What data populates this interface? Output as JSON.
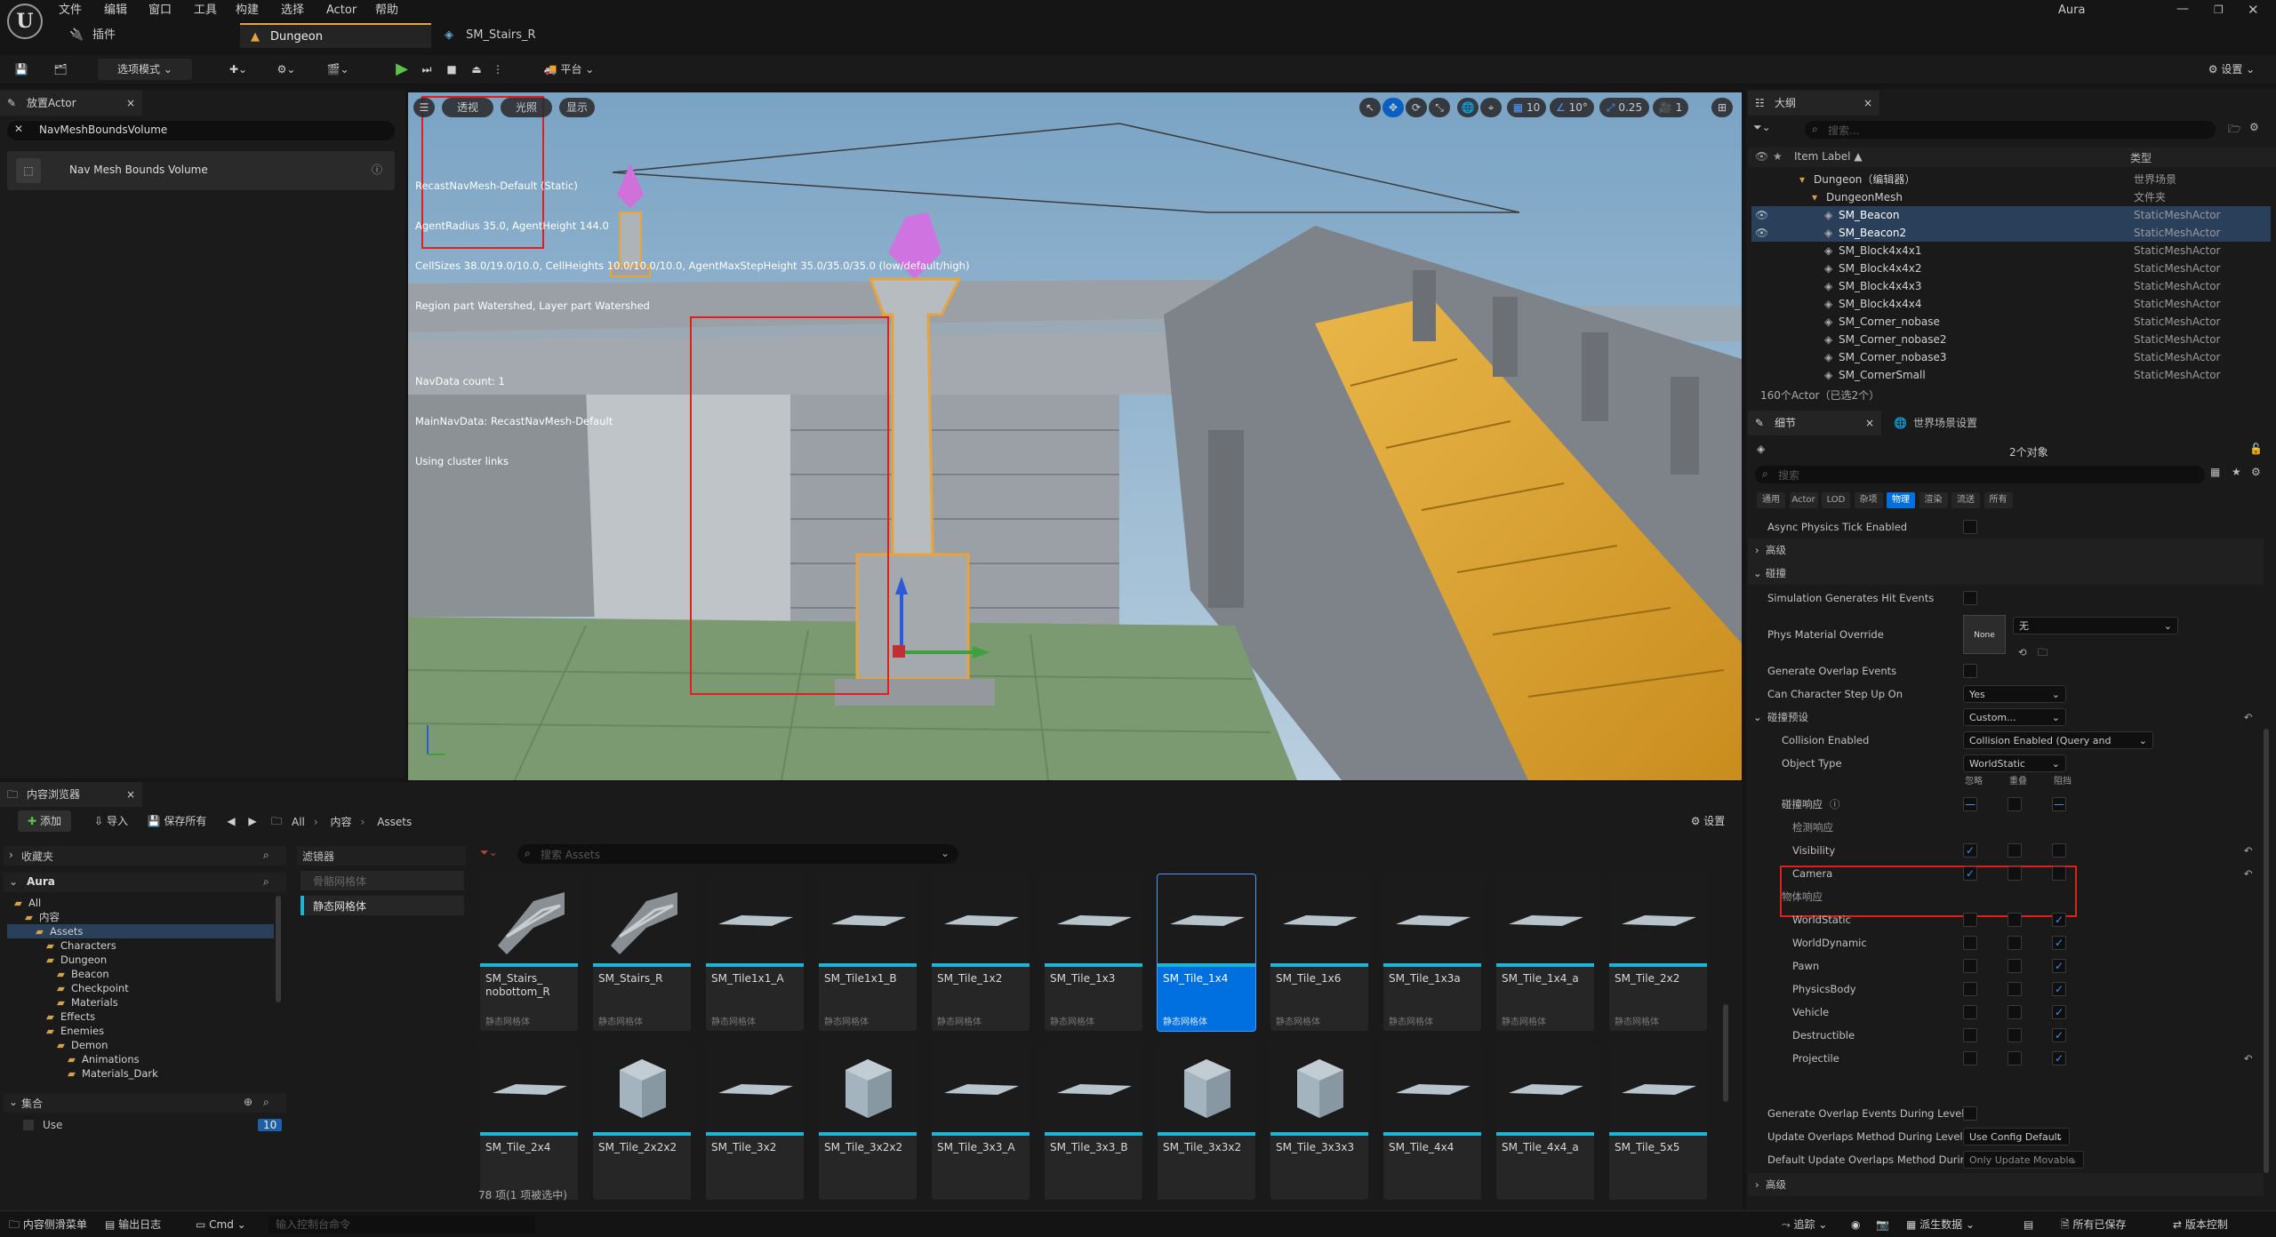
{
  "menubar": {
    "items": [
      "文件",
      "编辑",
      "窗口",
      "工具",
      "构建",
      "选择",
      "Actor",
      "帮助"
    ],
    "user": "Aura",
    "plugin_tab": "插件",
    "tabs": [
      "Dungeon",
      "SM_Stairs_R"
    ]
  },
  "toolbar": {
    "mode_label": "选项模式",
    "platform_label": "平台",
    "settings_label": "设置"
  },
  "place_actor": {
    "tab_label": "放置Actor",
    "search_value": "NavMeshBoundsVolume",
    "result_label": "Nav Mesh Bounds Volume"
  },
  "viewport": {
    "perspective_label": "透视",
    "lit_label": "光照",
    "show_label": "显示",
    "grid_value": "10",
    "angle_value": "10°",
    "scale_value": "0.25",
    "camera_speed": "1",
    "debug_lines": [
      "RecastNavMesh-Default (Static)",
      "AgentRadius 35.0, AgentHeight 144.0",
      "CellSizes 38.0/19.0/10.0, CellHeights 10.0/10.0/10.0, AgentMaxStepHeight 35.0/35.0/35.0 (low/default/high)",
      "Region part Watershed, Layer part Watershed",
      "",
      "NavData count: 1",
      "MainNavData: RecastNavMesh-Default",
      "Using cluster links"
    ]
  },
  "outliner": {
    "tab_label": "大纲",
    "search_placeholder": "搜索...",
    "col_label": "Item Label ▲",
    "col_type": "类型",
    "rows": [
      {
        "label": "Dungeon（编辑器）",
        "type": "世界场景",
        "indent": 1,
        "sel": false,
        "eye": false
      },
      {
        "label": "DungeonMesh",
        "type": "文件夹",
        "indent": 2,
        "sel": false,
        "eye": false
      },
      {
        "label": "SM_Beacon",
        "type": "StaticMeshActor",
        "indent": 3,
        "sel": true,
        "eye": true
      },
      {
        "label": "SM_Beacon2",
        "type": "StaticMeshActor",
        "indent": 3,
        "sel": true,
        "eye": true
      },
      {
        "label": "SM_Block4x4x1",
        "type": "StaticMeshActor",
        "indent": 3,
        "sel": false,
        "eye": false
      },
      {
        "label": "SM_Block4x4x2",
        "type": "StaticMeshActor",
        "indent": 3,
        "sel": false,
        "eye": false
      },
      {
        "label": "SM_Block4x4x3",
        "type": "StaticMeshActor",
        "indent": 3,
        "sel": false,
        "eye": false
      },
      {
        "label": "SM_Block4x4x4",
        "type": "StaticMeshActor",
        "indent": 3,
        "sel": false,
        "eye": false
      },
      {
        "label": "SM_Corner_nobase",
        "type": "StaticMeshActor",
        "indent": 3,
        "sel": false,
        "eye": false
      },
      {
        "label": "SM_Corner_nobase2",
        "type": "StaticMeshActor",
        "indent": 3,
        "sel": false,
        "eye": false
      },
      {
        "label": "SM_Corner_nobase3",
        "type": "StaticMeshActor",
        "indent": 3,
        "sel": false,
        "eye": false
      },
      {
        "label": "SM_CornerSmall",
        "type": "StaticMeshActor",
        "indent": 3,
        "sel": false,
        "eye": false
      }
    ],
    "footer": "160个Actor（已选2个）"
  },
  "details": {
    "tab_label": "细节",
    "world_tab_label": "世界场景设置",
    "object_count": "2个对象",
    "search_placeholder": "搜索",
    "filters": [
      "通用",
      "Actor",
      "LOD",
      "杂项",
      "物理",
      "渲染",
      "流送",
      "所有"
    ],
    "active_filter": "物理",
    "rows": {
      "async": "Async Physics Tick Enabled",
      "advanced1": "高级",
      "collision": "碰撞",
      "sim_hit": "Simulation Generates Hit Events",
      "phys_mat": "Phys Material Override",
      "phys_mat_none": "None",
      "phys_mat_value": "无",
      "gen_overlap": "Generate Overlap Events",
      "step_up": "Can Character Step Up On",
      "step_up_value": "Yes",
      "presets": "碰撞预设",
      "presets_value": "Custom...",
      "coll_enabled": "Collision Enabled",
      "coll_enabled_value": "Collision Enabled (Query and Physics)",
      "obj_type": "Object Type",
      "obj_type_value": "WorldStatic",
      "col_ignore": "忽略",
      "col_overlap": "重叠",
      "col_block": "阻挡",
      "responses": "碰撞响应",
      "trace_resp": "检测响应",
      "visibility": "Visibility",
      "camera": "Camera",
      "obj_resp": "物体响应",
      "world_static": "WorldStatic",
      "world_dynamic": "WorldDynamic",
      "pawn": "Pawn",
      "physics_body": "PhysicsBody",
      "vehicle": "Vehicle",
      "destructible": "Destructible",
      "projectile": "Projectile",
      "gen_overlap_level": "Generate Overlap Events During Level...",
      "update_method": "Update Overlaps Method During Level...",
      "update_method_value": "Use Config Default",
      "default_update": "Default Update Overlaps Method During...",
      "default_update_value": "Only Update Movable",
      "advanced2": "高级"
    }
  },
  "content_browser": {
    "tab_label": "内容浏览器",
    "add_label": "添加",
    "import_label": "导入",
    "save_all_label": "保存所有",
    "breadcrumb": [
      "All",
      "内容",
      "Assets"
    ],
    "settings_label": "设置",
    "favorites_label": "收藏夹",
    "project_label": "Aura",
    "filters_label": "滤镜器",
    "filter_items": [
      "骨骼网格体",
      "静态网格体"
    ],
    "search_placeholder": "搜索 Assets",
    "tree": [
      {
        "label": "All",
        "depth": 0
      },
      {
        "label": "内容",
        "depth": 1
      },
      {
        "label": "Assets",
        "depth": 2
      },
      {
        "label": "Characters",
        "depth": 3
      },
      {
        "label": "Dungeon",
        "depth": 3
      },
      {
        "label": "Beacon",
        "depth": 4
      },
      {
        "label": "Checkpoint",
        "depth": 4
      },
      {
        "label": "Materials",
        "depth": 4
      },
      {
        "label": "Effects",
        "depth": 3
      },
      {
        "label": "Enemies",
        "depth": 3
      },
      {
        "label": "Demon",
        "depth": 4
      },
      {
        "label": "Animations",
        "depth": 5
      },
      {
        "label": "Materials_Dark",
        "depth": 5
      }
    ],
    "collections_label": "集合",
    "collection_item": "Use",
    "collection_count": "10",
    "asset_type": "静态网格体",
    "assets_row1": [
      "SM_Stairs_\nnobottom_R",
      "SM_Stairs_R",
      "SM_Tile1x1_A",
      "SM_Tile1x1_B",
      "SM_Tile_1x2",
      "SM_Tile_1x3",
      "SM_Tile_1x4",
      "SM_Tile_1x6",
      "SM_Tile_1x3a",
      "SM_Tile_1x4_a",
      "SM_Tile_2x2"
    ],
    "assets_row2": [
      "SM_Tile_2x4",
      "SM_Tile_2x2x2",
      "SM_Tile_3x2",
      "SM_Tile_3x2x2",
      "SM_Tile_3x3_A",
      "SM_Tile_3x3_B",
      "SM_Tile_3x3x2",
      "SM_Tile_3x3x3",
      "SM_Tile_4x4",
      "SM_Tile_4x4_a",
      "SM_Tile_5x5"
    ],
    "selected_asset": "SM_Tile_1x4",
    "item_count": "78 项(1 项被选中)"
  },
  "statusbar": {
    "drawer": "内容侧滑菜单",
    "output_log": "输出日志",
    "cmd": "Cmd",
    "cmd_placeholder": "输入控制台命令",
    "trace": "追踪",
    "derived": "派生数据",
    "saved": "所有已保存",
    "version": "版本控制"
  },
  "colors": {
    "accent": "#e8a33a",
    "select": "#0070e0",
    "cyan": "#1fb3d6",
    "highlight_box": "#e02020"
  }
}
